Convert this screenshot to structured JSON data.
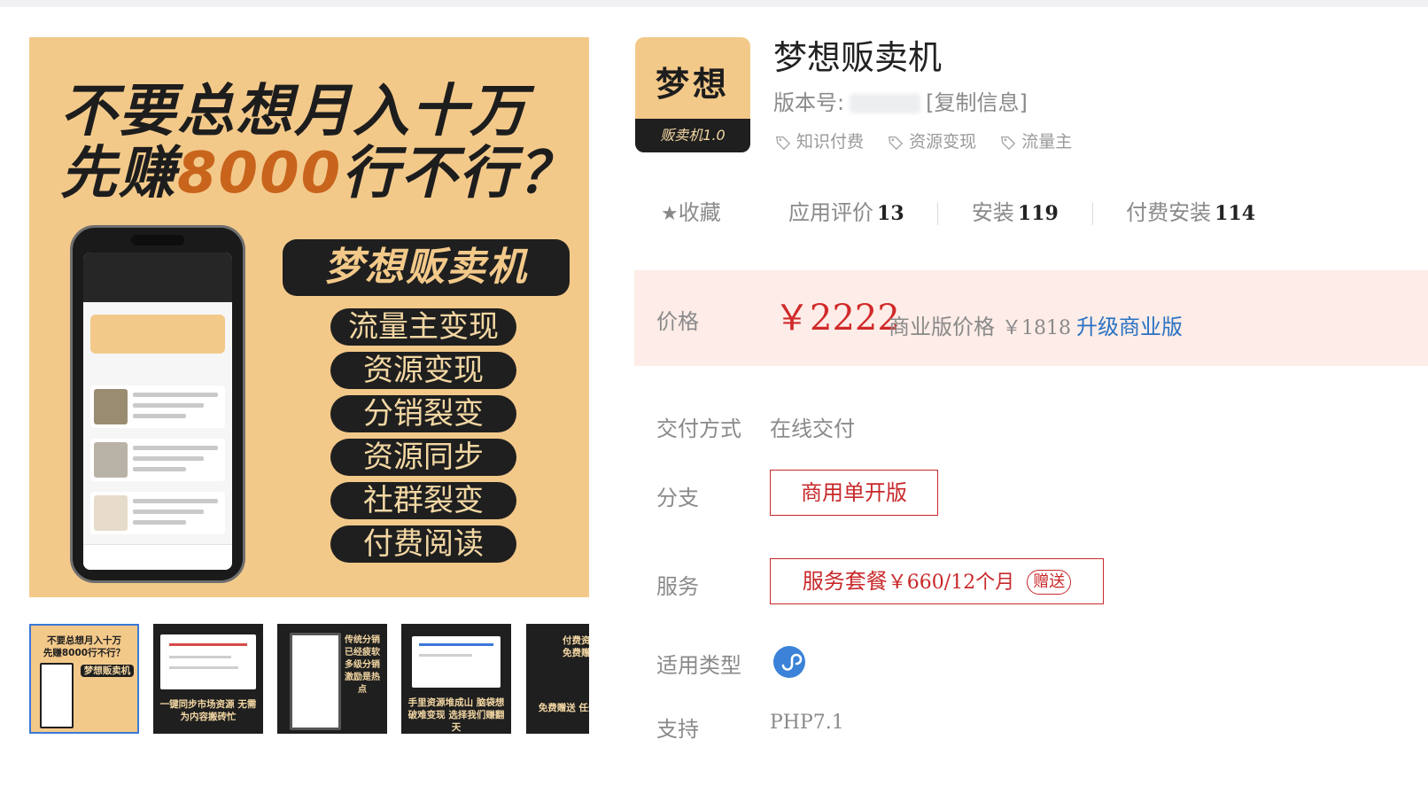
{
  "gallery": {
    "main_image": {
      "headline_line1": "不要总想月入十万",
      "headline_line2_prefix": "先赚",
      "headline_line2_highlight": "8000",
      "headline_line2_suffix": "行不行？",
      "product_banner": "梦想贩卖机",
      "features": [
        "流量主变现",
        "资源变现",
        "分销裂变",
        "资源同步",
        "社群裂变",
        "付费阅读"
      ]
    },
    "thumbnails": [
      {
        "line1": "不要总想月入十万",
        "line2": "先赚8000行不行？",
        "badge": "梦想贩卖机"
      },
      {
        "caption": "一键同步市场资源 无需为内容搬砖忙"
      },
      {
        "caption": "传统分销已经疲软 多级分销激励是热点"
      },
      {
        "caption": "手里资源堆成山 脑袋想破难变现 选择我们赚翻天"
      },
      {
        "line1": "付费资源",
        "line2": "免费赠送",
        "caption": "免费赠送 任务+流量"
      }
    ]
  },
  "app": {
    "icon_text": "梦想",
    "icon_band_text": "贩卖机1.0",
    "title": "梦想贩卖机",
    "version_label": "版本号:",
    "copy_info": "[复制信息]",
    "tags": [
      "知识付费",
      "资源变现",
      "流量主"
    ]
  },
  "stats": {
    "favorite_label": "收藏",
    "rating_label": "应用评价",
    "rating_count": "13",
    "install_label": "安装",
    "install_count": "119",
    "paid_install_label": "付费安装",
    "paid_install_count": "114"
  },
  "price": {
    "label": "价格",
    "value": "￥2222",
    "commercial_label": "商业版价格",
    "commercial_value": "￥1818",
    "upgrade_link": "升级商业版"
  },
  "details": {
    "delivery_label": "交付方式",
    "delivery_value": "在线交付",
    "branch_label": "分支",
    "branch_option": "商用单开版",
    "service_label": "服务",
    "service_option_prefix": "服务套餐",
    "service_option_price": "￥660/12个月",
    "service_gift": "赠送",
    "type_label": "适用类型",
    "type_icon": "mini-program-icon",
    "support_label": "支持",
    "support_value": "PHP7.1"
  },
  "colors": {
    "accent_red": "#c8282a",
    "price_red": "#d12a2a",
    "price_bg": "#fdece7",
    "link_blue": "#2a72c4",
    "promo_gold": "#f3c98a",
    "promo_dark": "#1f1f1f"
  }
}
